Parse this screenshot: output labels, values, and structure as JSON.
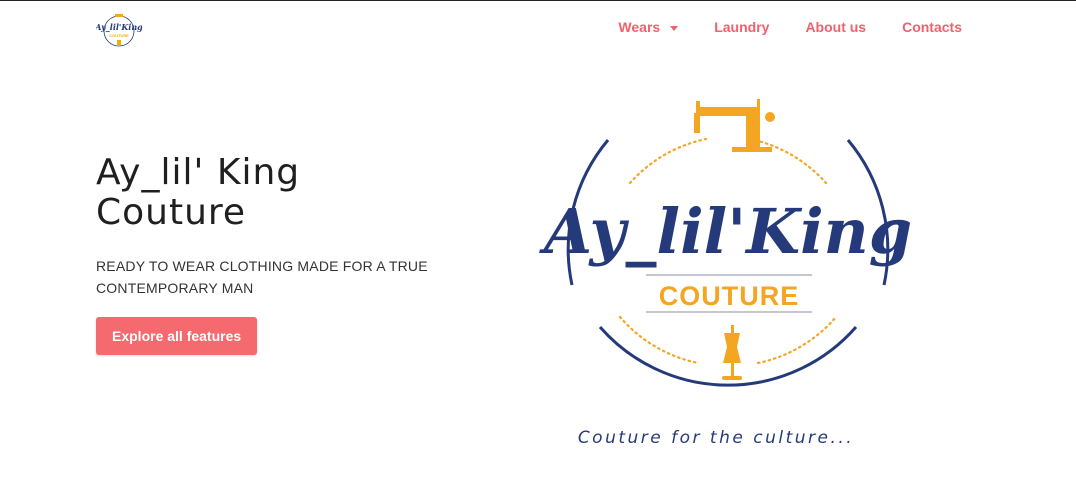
{
  "brand": {
    "name_main": "Ay_lil'King",
    "name_sub": "COUTURE",
    "tagline": "Couture for the culture...",
    "colors": {
      "navy": "#253a7a",
      "gold": "#f4a623",
      "accent": "#f0616d"
    }
  },
  "nav": {
    "items": [
      {
        "label": "Wears",
        "has_dropdown": true
      },
      {
        "label": "Laundry"
      },
      {
        "label": "About us"
      },
      {
        "label": "Contacts"
      }
    ]
  },
  "hero": {
    "title_line1": "Ay_lil' King",
    "title_line2": "Couture",
    "subtitle_line1": "READY TO WEAR CLOTHING MADE FOR A TRUE",
    "subtitle_line2": "CONTEMPORARY MAN",
    "cta_label": "Explore all features"
  },
  "icons": [
    "sewing-machine-icon",
    "dress-form-icon",
    "chevron-down-icon"
  ]
}
